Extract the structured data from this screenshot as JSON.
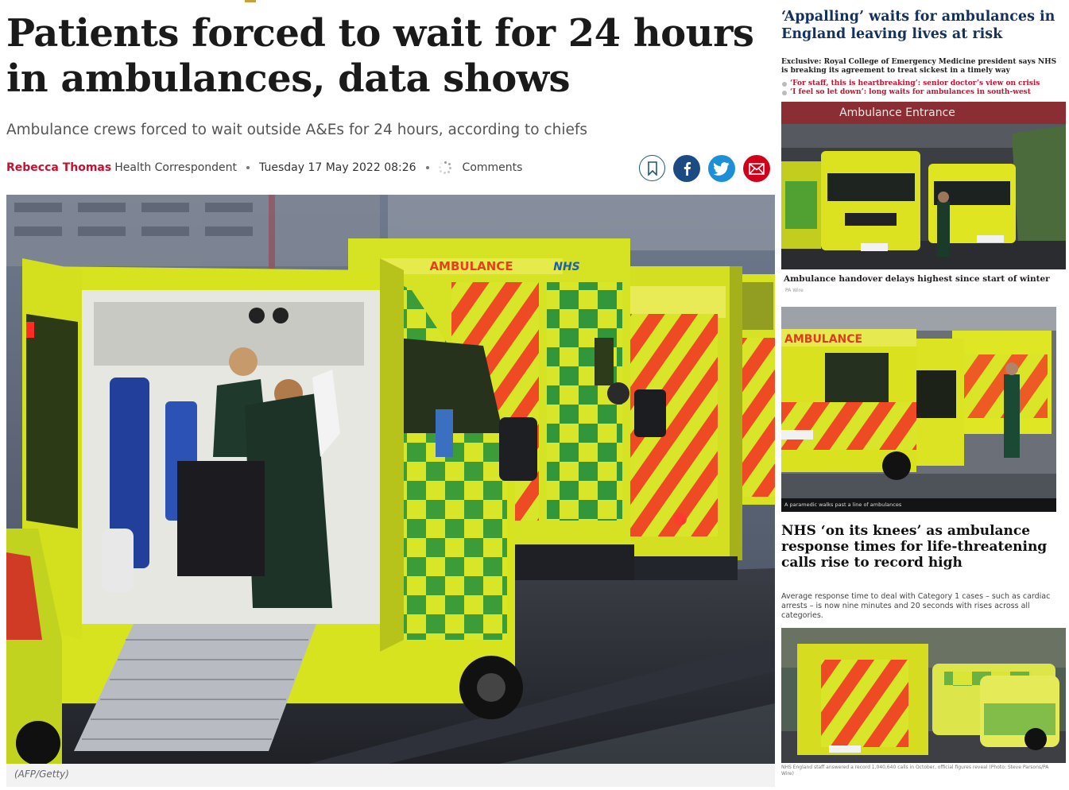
{
  "article": {
    "headline": "Patients forced to wait for 24 hours in ambulances, data shows",
    "standfirst": "Ambulance crews forced to wait outside A&Es for 24 hours, according to chiefs",
    "author": "Rebecca Thomas",
    "role": "Health Correspondent",
    "date": "Tuesday 17 May 2022 08:26",
    "comments_label": "Comments",
    "hero_credit": "(AFP/Getty)",
    "hero_signage": {
      "ambulance": "AMBULANCE",
      "nhs": "NHS"
    }
  },
  "share": {
    "bookmark_icon": "bookmark-icon",
    "facebook_icon": "facebook-icon",
    "twitter_icon": "twitter-icon",
    "email_icon": "email-icon"
  },
  "sidebar": {
    "story1": {
      "headline": "‘Appalling’ waits for ambulances in England leaving lives at risk",
      "summary": "Exclusive: Royal College of Emergency Medicine president says NHS is breaking its agreement to treat sickest in a timely way",
      "links": [
        "‘For staff, this is heartbreaking’: senior doctor’s view on crisis",
        "‘I feel so let down’: long waits for ambulances in south-west"
      ],
      "sign_text": "Ambulance Entrance"
    },
    "story2": {
      "caption": "Ambulance handover delays highest since start of winter",
      "credit": "PA Wire",
      "overlay_caption": "A paramedic walks past a line of ambulances",
      "sign_text": "AMBULANCE"
    },
    "story3": {
      "headline": "NHS ‘on its knees’ as ambulance response times for life-threatening calls rise to record high",
      "summary": "Average response time to deal with Category 1 cases – such as cardiac arrests – is now nine minutes and 20 seconds with rises across all categories.",
      "caption": "NHS England staff answered a record 1,040,640 calls in October, official figures reveal (Photo: Steve Parsons/PA Wire)"
    }
  },
  "colors": {
    "author_red": "#c8102e",
    "headline_navy": "#14325c",
    "facebook_blue": "#1b4b82",
    "twitter_blue": "#1d8fd6",
    "email_red": "#d0021b",
    "ambulance_yellow": "#d7e422",
    "chevron_red": "#e84a2a",
    "nhs_green": "#0b7a3e"
  }
}
